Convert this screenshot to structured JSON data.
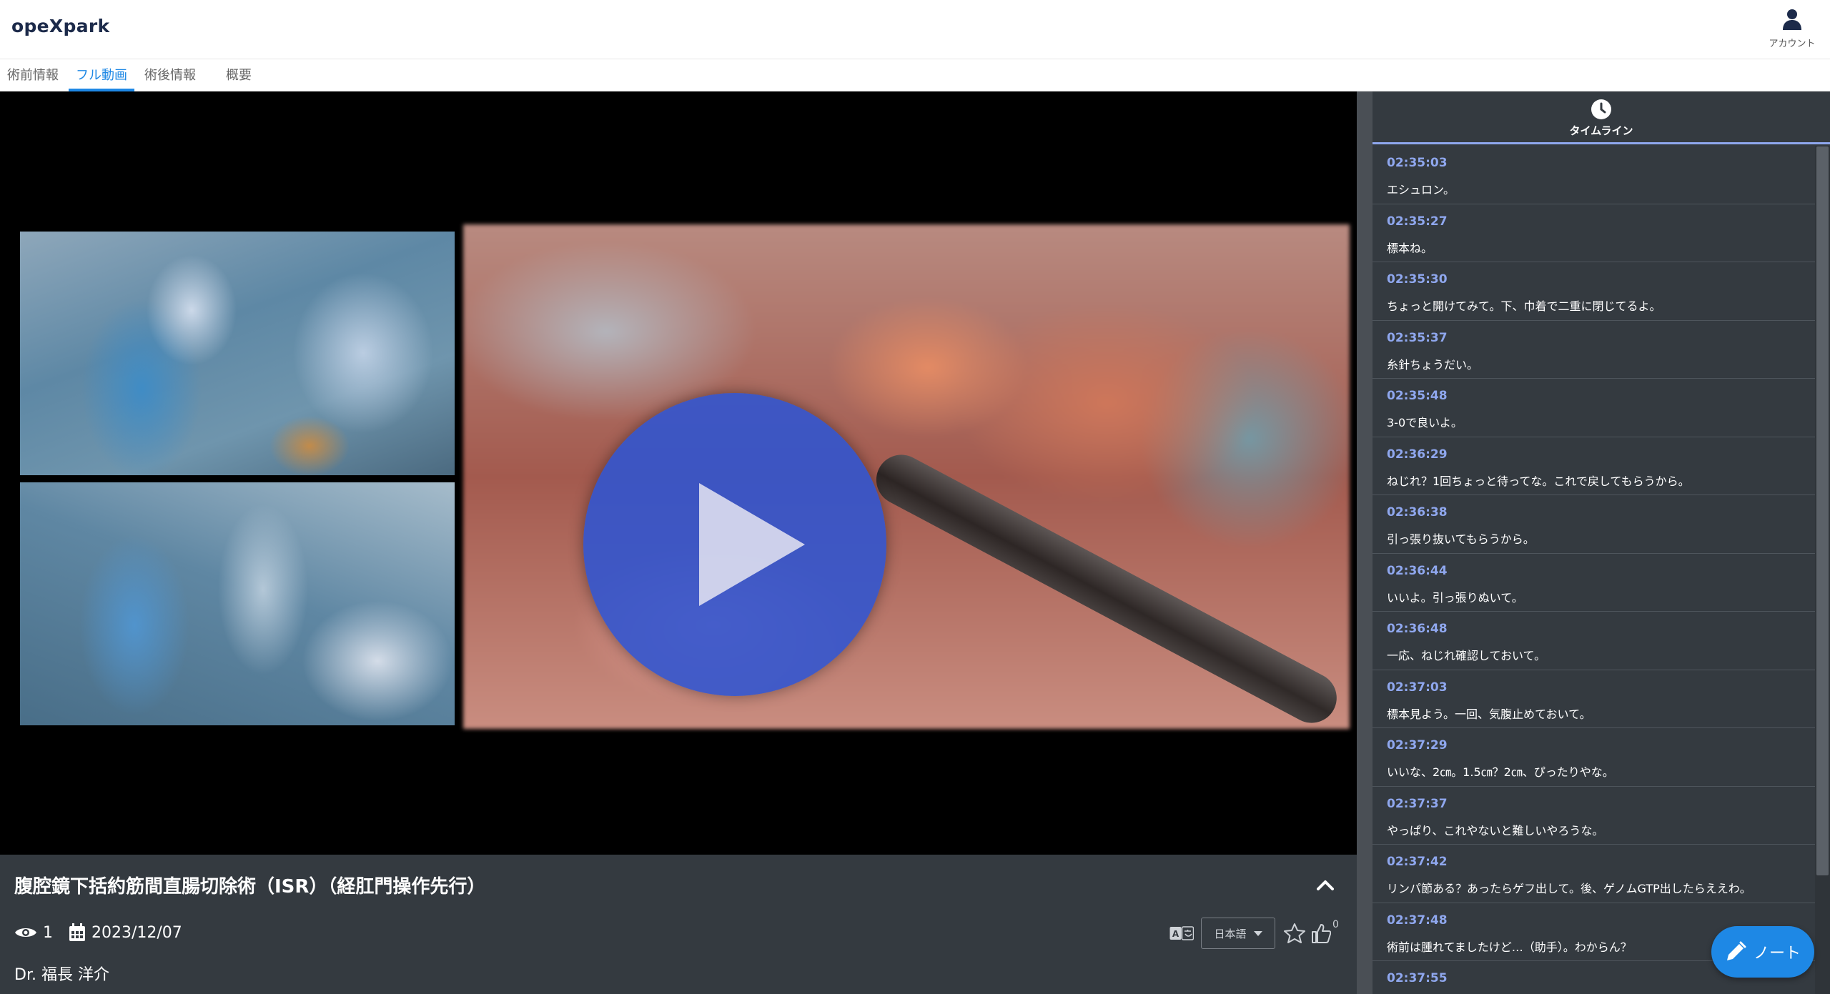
{
  "header": {
    "logo": "opeXpark",
    "account_label": "アカウント"
  },
  "tabs": [
    {
      "label": "術前情報"
    },
    {
      "label": "フル動画"
    },
    {
      "label": "術後情報"
    },
    {
      "label": "概要"
    }
  ],
  "active_tab": "フル動画",
  "video": {
    "title": "腹腔鏡下括約筋間直腸切除術（ISR）（経肛門操作先行）",
    "views": "1",
    "date": "2023/12/07",
    "doctor": "Dr. 福長 洋介",
    "language": "日本語",
    "likes": "0"
  },
  "sidebar": {
    "title": "タイムライン"
  },
  "timeline": [
    {
      "time": "02:35:03",
      "text": "エシュロン。"
    },
    {
      "time": "02:35:27",
      "text": "標本ね。"
    },
    {
      "time": "02:35:30",
      "text": "ちょっと開けてみて。下、巾着で二重に閉じてるよ。"
    },
    {
      "time": "02:35:37",
      "text": "糸針ちょうだい。"
    },
    {
      "time": "02:35:48",
      "text": "3-0で良いよ。"
    },
    {
      "time": "02:36:29",
      "text": "ねじれ？1回ちょっと待ってな。これで戻してもらうから。"
    },
    {
      "time": "02:36:38",
      "text": "引っ張り抜いてもらうから。"
    },
    {
      "time": "02:36:44",
      "text": "いいよ。引っ張りぬいて。"
    },
    {
      "time": "02:36:48",
      "text": "一応、ねじれ確認しておいて。"
    },
    {
      "time": "02:37:03",
      "text": "標本見よう。一回、気腹止めておいて。"
    },
    {
      "time": "02:37:29",
      "text": "いいな、2㎝。1.5㎝？2㎝、ぴったりやな。"
    },
    {
      "time": "02:37:37",
      "text": "やっぱり、これやないと難しいやろうな。"
    },
    {
      "time": "02:37:42",
      "text": "リンパ節ある？あったらゲフ出して。後、ゲノムGTP出したらええわ。"
    },
    {
      "time": "02:37:48",
      "text": "術前は腫れてましたけど…（助手）。わからん？"
    },
    {
      "time": "02:37:55",
      "text": ""
    }
  ],
  "note_button": {
    "label": "ノート"
  },
  "colors": {
    "accent": "#1e88e5",
    "timestamp": "#8fa7ee",
    "panel_bg": "#343a40",
    "play_button": "#2f54d2"
  }
}
